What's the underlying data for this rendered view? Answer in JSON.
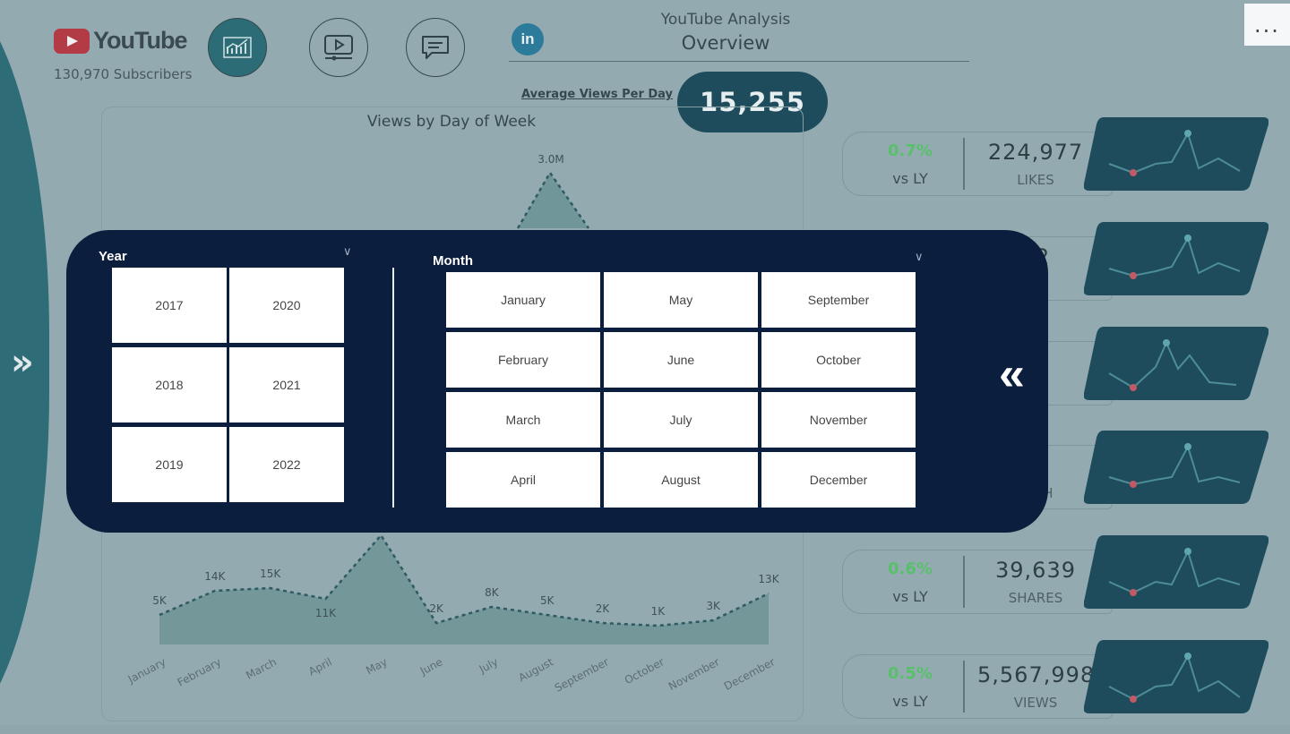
{
  "brand": {
    "name": "YouTube",
    "subscribers": "130,970 Subscribers"
  },
  "header": {
    "title": "YouTube Analysis",
    "subtitle": "Overview",
    "avg_label": "Average Views Per Day",
    "avg_value": "15,255"
  },
  "nav": [
    {
      "icon": "line-chart-icon",
      "active": true
    },
    {
      "icon": "video-icon",
      "active": false
    },
    {
      "icon": "comment-icon",
      "active": false
    },
    {
      "icon": "linkedin-icon",
      "active": false
    }
  ],
  "linkedin_text": "in",
  "more_menu": "...",
  "expand_glyph": "»",
  "collapse_glyph": "«",
  "chart": {
    "title": "Views by Day of Week",
    "peak_label": "3.0M",
    "month_points": [
      {
        "m": "January",
        "label": "5K",
        "v": 5
      },
      {
        "m": "February",
        "label": "14K",
        "v": 14
      },
      {
        "m": "March",
        "label": "15K",
        "v": 15
      },
      {
        "m": "April",
        "label": "11K",
        "v": 11
      },
      {
        "m": "May",
        "label": "",
        "v": 0
      },
      {
        "m": "June",
        "label": "2K",
        "v": 2
      },
      {
        "m": "July",
        "label": "8K",
        "v": 8
      },
      {
        "m": "August",
        "label": "5K",
        "v": 5
      },
      {
        "m": "September",
        "label": "2K",
        "v": 2
      },
      {
        "m": "October",
        "label": "1K",
        "v": 1
      },
      {
        "m": "November",
        "label": "3K",
        "v": 3
      },
      {
        "m": "December",
        "label": "13K",
        "v": 13
      }
    ]
  },
  "kpis": [
    {
      "pct": "0.7%",
      "vsly": "vs LY",
      "value": "224,977",
      "caption": "LIKES"
    },
    {
      "pct": "",
      "vsly": "",
      "value": "02",
      "caption": "ES"
    },
    {
      "pct": "",
      "vsly": "",
      "value": "95",
      "caption": "NTS"
    },
    {
      "pct": "",
      "vsly": "",
      "value": "97",
      "caption": "ATCH"
    },
    {
      "pct": "0.6%",
      "vsly": "vs LY",
      "value": "39,639",
      "caption": "SHARES"
    },
    {
      "pct": "0.5%",
      "vsly": "vs LY",
      "value": "5,567,998",
      "caption": "VIEWS"
    }
  ],
  "filters": {
    "year_label": "Year",
    "month_label": "Month",
    "years": [
      "2017",
      "2020",
      "2018",
      "2021",
      "2019",
      "2022"
    ],
    "months": [
      "January",
      "May",
      "September",
      "February",
      "June",
      "October",
      "March",
      "July",
      "November",
      "April",
      "August",
      "December"
    ]
  },
  "colors": {
    "teal_dark": "#1f4c5c",
    "overlay": "#0c1e3d",
    "positive": "#58c06a"
  }
}
